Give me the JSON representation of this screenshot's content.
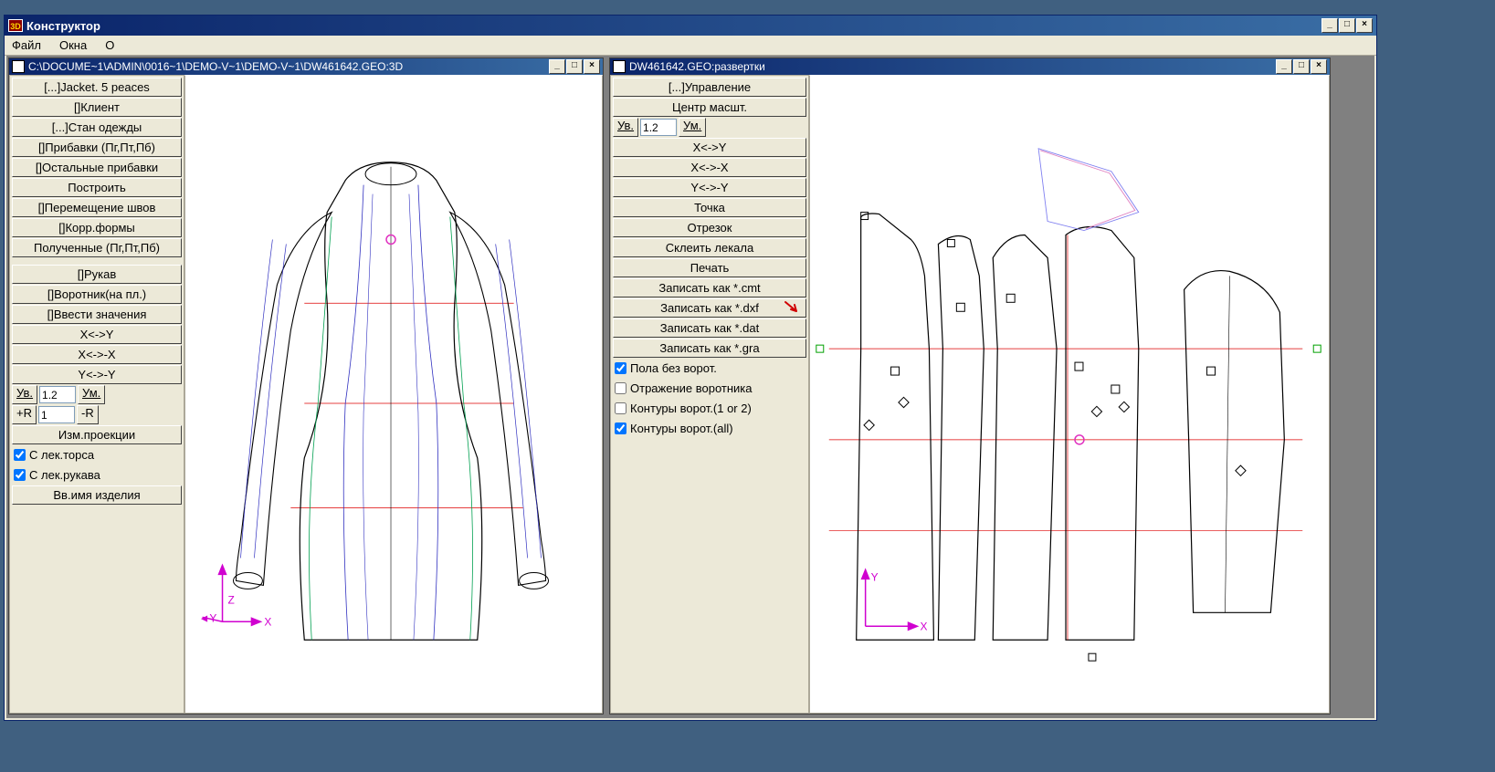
{
  "app": {
    "title": "Конструктор",
    "icon_text": "3D",
    "menu": {
      "file": "Файл",
      "windows": "Окна",
      "about": "О"
    }
  },
  "win3d": {
    "title": "C:\\DOCUME~1\\ADMIN\\0016~1\\DEMO-V~1\\DEMO-V~1\\DW461642.GEO:3D",
    "buttons": {
      "jacket": "[...]Jacket. 5 peaces",
      "client": "[]Клиент",
      "stan": "[...]Стан одежды",
      "pribavki": "[]Прибавки (Пг,Пт,Пб)",
      "ost_pribavki": "[]Остальные прибавки",
      "build": "Построить",
      "move_seams": "[]Перемещение швов",
      "corr_forms": "[]Корр.формы",
      "received": "Полученные (Пг,Пт,Пб)",
      "sleeve": "[]Рукав",
      "collar": "[]Воротник(на пл.)",
      "enter_values": "[]Ввести значения",
      "xy": "X<->Y",
      "xx": "X<->-X",
      "yy": "Y<->-Y",
      "uv_label": "Ув.",
      "uv_value": "1.2",
      "um_label": "Ум.",
      "plusR": "+R",
      "r_value": "1",
      "minusR": "-R",
      "proj": "Изм.проекции",
      "chk_torso": "С лек.торса",
      "chk_sleeve": "С лек.рукава",
      "name_product": "Вв.имя изделия"
    }
  },
  "win2d": {
    "title": "DW461642.GEO:развертки",
    "buttons": {
      "control": "[...]Управление",
      "center_scale": "Центр масшт.",
      "uv_label": "Ув.",
      "uv_value": "1.2",
      "um_label": "Ум.",
      "xy": "X<->Y",
      "xx": "X<->-X",
      "yy": "Y<->-Y",
      "point": "Точка",
      "segment": "Отрезок",
      "glue": "Склеить лекала",
      "print": "Печать",
      "save_cmt": "Записать как *.cmt",
      "save_dxf": "Записать как *.dxf",
      "save_dat": "Записать как *.dat",
      "save_gra": "Записать как *.gra",
      "chk_pola": "Пола без ворот.",
      "chk_reflect": "Отражение воротника",
      "chk_contour1": "Контуры ворот.(1 or 2)",
      "chk_contour_all": "Контуры ворот.(all)"
    }
  }
}
